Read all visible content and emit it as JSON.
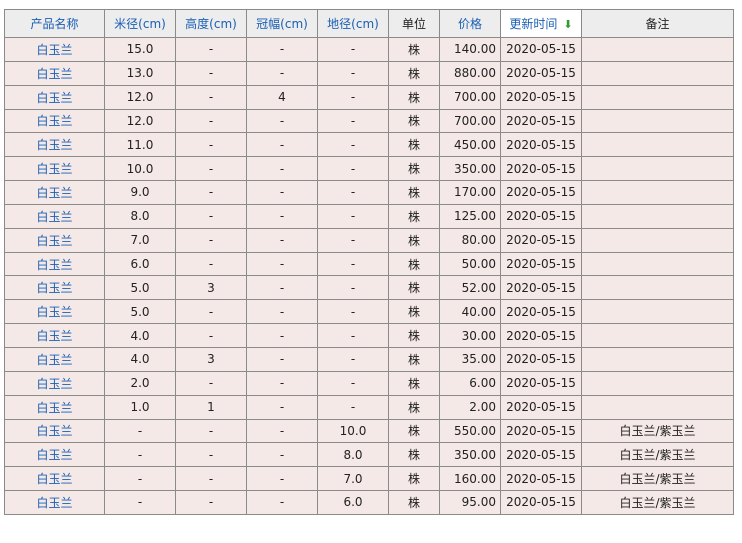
{
  "columns": [
    {
      "label": "产品名称",
      "sortable": true
    },
    {
      "label": "米径(cm)",
      "sortable": true
    },
    {
      "label": "高度(cm)",
      "sortable": true
    },
    {
      "label": "冠幅(cm)",
      "sortable": true
    },
    {
      "label": "地径(cm)",
      "sortable": true
    },
    {
      "label": "单位",
      "sortable": false
    },
    {
      "label": "价格",
      "sortable": true
    },
    {
      "label": "更新时间",
      "sortable": true,
      "sorted": "desc",
      "sort_icon": "arrow-down-icon"
    },
    {
      "label": "备注",
      "sortable": false
    }
  ],
  "rows": [
    [
      "白玉兰",
      "15.0",
      "-",
      "-",
      "-",
      "株",
      "140.00",
      "2020-05-15",
      ""
    ],
    [
      "白玉兰",
      "13.0",
      "-",
      "-",
      "-",
      "株",
      "880.00",
      "2020-05-15",
      ""
    ],
    [
      "白玉兰",
      "12.0",
      "-",
      "4",
      "-",
      "株",
      "700.00",
      "2020-05-15",
      ""
    ],
    [
      "白玉兰",
      "12.0",
      "-",
      "-",
      "-",
      "株",
      "700.00",
      "2020-05-15",
      ""
    ],
    [
      "白玉兰",
      "11.0",
      "-",
      "-",
      "-",
      "株",
      "450.00",
      "2020-05-15",
      ""
    ],
    [
      "白玉兰",
      "10.0",
      "-",
      "-",
      "-",
      "株",
      "350.00",
      "2020-05-15",
      ""
    ],
    [
      "白玉兰",
      "9.0",
      "-",
      "-",
      "-",
      "株",
      "170.00",
      "2020-05-15",
      ""
    ],
    [
      "白玉兰",
      "8.0",
      "-",
      "-",
      "-",
      "株",
      "125.00",
      "2020-05-15",
      ""
    ],
    [
      "白玉兰",
      "7.0",
      "-",
      "-",
      "-",
      "株",
      "80.00",
      "2020-05-15",
      ""
    ],
    [
      "白玉兰",
      "6.0",
      "-",
      "-",
      "-",
      "株",
      "50.00",
      "2020-05-15",
      ""
    ],
    [
      "白玉兰",
      "5.0",
      "3",
      "-",
      "-",
      "株",
      "52.00",
      "2020-05-15",
      ""
    ],
    [
      "白玉兰",
      "5.0",
      "-",
      "-",
      "-",
      "株",
      "40.00",
      "2020-05-15",
      ""
    ],
    [
      "白玉兰",
      "4.0",
      "-",
      "-",
      "-",
      "株",
      "30.00",
      "2020-05-15",
      ""
    ],
    [
      "白玉兰",
      "4.0",
      "3",
      "-",
      "-",
      "株",
      "35.00",
      "2020-05-15",
      ""
    ],
    [
      "白玉兰",
      "2.0",
      "-",
      "-",
      "-",
      "株",
      "6.00",
      "2020-05-15",
      ""
    ],
    [
      "白玉兰",
      "1.0",
      "1",
      "-",
      "-",
      "株",
      "2.00",
      "2020-05-15",
      ""
    ],
    [
      "白玉兰",
      "-",
      "-",
      "-",
      "10.0",
      "株",
      "550.00",
      "2020-05-15",
      "白玉兰/紫玉兰"
    ],
    [
      "白玉兰",
      "-",
      "-",
      "-",
      "8.0",
      "株",
      "350.00",
      "2020-05-15",
      "白玉兰/紫玉兰"
    ],
    [
      "白玉兰",
      "-",
      "-",
      "-",
      "7.0",
      "株",
      "160.00",
      "2020-05-15",
      "白玉兰/紫玉兰"
    ],
    [
      "白玉兰",
      "-",
      "-",
      "-",
      "6.0",
      "株",
      "95.00",
      "2020-05-15",
      "白玉兰/紫玉兰"
    ]
  ]
}
